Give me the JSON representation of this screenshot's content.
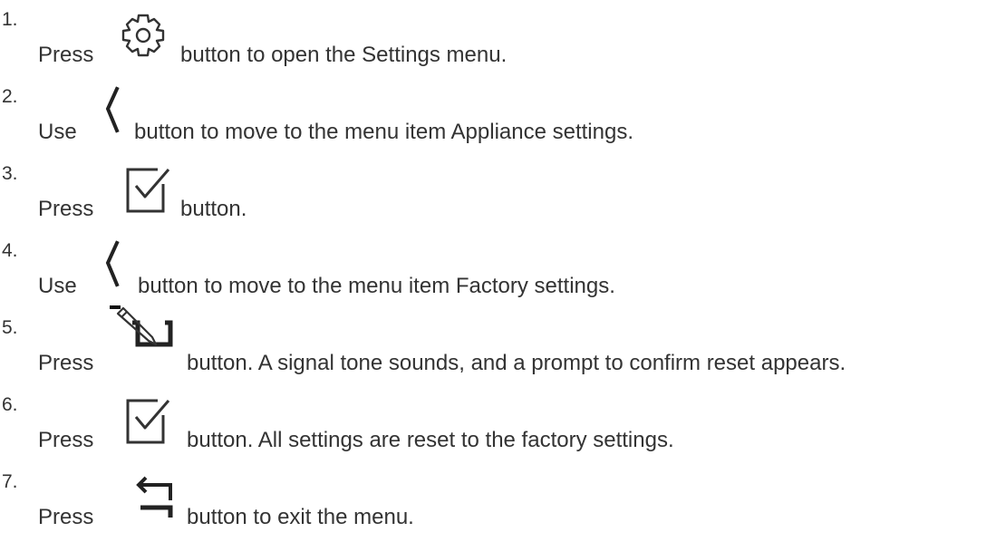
{
  "steps": [
    {
      "number": "1.",
      "verb": "Press",
      "icon": "gear-icon",
      "text": "button to open the Settings menu."
    },
    {
      "number": "2.",
      "verb": "Use",
      "icon": "chevron-left-icon",
      "text": "button to move to the menu item Appliance settings."
    },
    {
      "number": "3.",
      "verb": "Press",
      "icon": "checkbox-check-icon",
      "text": "button."
    },
    {
      "number": "4.",
      "verb": "Use",
      "icon": "chevron-left-icon",
      "text": "button to move to the menu item Factory settings."
    },
    {
      "number": "5.",
      "verb": "Press",
      "icon": "edit-pencil-box-icon",
      "text": "button. A signal tone sounds, and a prompt to confirm reset appears."
    },
    {
      "number": "6.",
      "verb": "Press",
      "icon": "checkbox-check-icon",
      "text": "button. All settings are reset to the factory settings."
    },
    {
      "number": "7.",
      "verb": "Press",
      "icon": "back-arrow-icon",
      "text": "button to exit the menu."
    }
  ]
}
